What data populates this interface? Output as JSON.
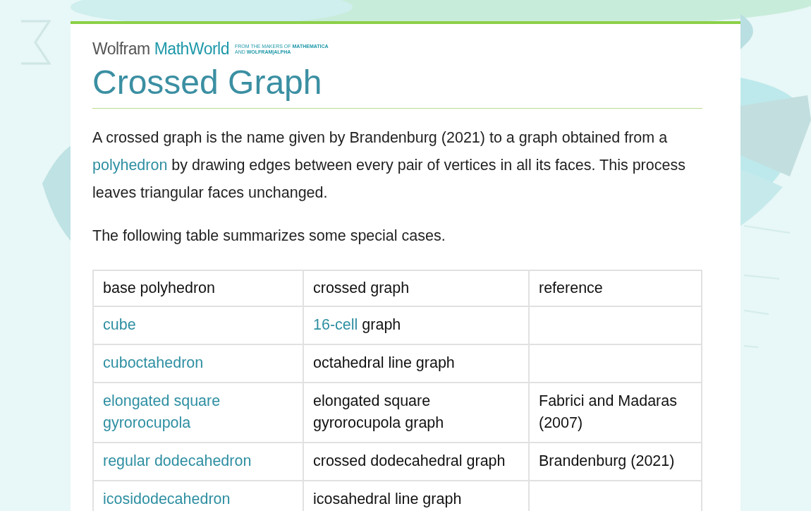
{
  "logo": {
    "brand": "Wolfram",
    "product": "MathWorld",
    "tagline": [
      "FROM THE MAKERS OF **MATHEMATICA**",
      "AND **WOLFRAM|ALPHA**"
    ]
  },
  "title": "Crossed Graph",
  "paragraphs": [
    [
      {
        "text": "A crossed graph is the name given by Brandenburg (2021) to a graph obtained from a ",
        "link": false
      },
      {
        "text": "polyhedron",
        "link": true
      },
      {
        "text": " by drawing edges between every pair of vertices in all its faces. This process leaves triangular faces unchanged.",
        "link": false
      }
    ],
    [
      {
        "text": "The following table summarizes some special cases.",
        "link": false
      }
    ]
  ],
  "table": {
    "columns": [
      "base polyhedron",
      "crossed graph",
      "reference"
    ],
    "rows": [
      [
        [
          {
            "text": "cube",
            "link": true
          }
        ],
        [
          {
            "text": "16-cell",
            "link": true
          },
          {
            "text": " graph",
            "link": false
          }
        ],
        []
      ],
      [
        [
          {
            "text": "cuboctahedron",
            "link": true
          }
        ],
        [
          {
            "text": "octahedral line graph",
            "link": false
          }
        ],
        []
      ],
      [
        [
          {
            "text": "elongated square gyrorocupola",
            "link": true
          }
        ],
        [
          {
            "text": "elongated square gyrorocupola graph",
            "link": false
          }
        ],
        [
          {
            "text": "Fabrici and Madaras (2007)",
            "link": false
          }
        ]
      ],
      [
        [
          {
            "text": "regular dodecahedron",
            "link": true
          }
        ],
        [
          {
            "text": "crossed dodecahedral graph",
            "link": false
          }
        ],
        [
          {
            "text": "Brandenburg (2021)",
            "link": false
          }
        ]
      ],
      [
        [
          {
            "text": "icosidodecahedron",
            "link": true
          }
        ],
        [
          {
            "text": "icosahedral line graph",
            "link": false
          }
        ],
        []
      ]
    ]
  }
}
